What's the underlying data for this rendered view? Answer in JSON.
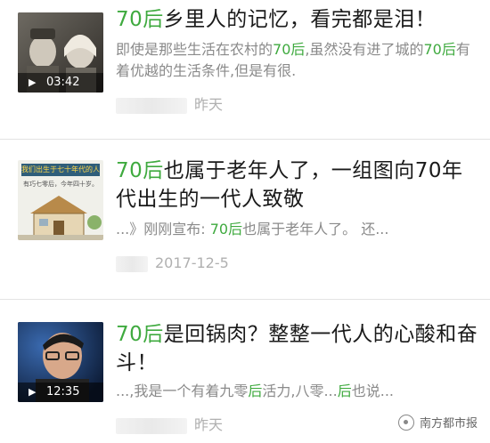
{
  "items": [
    {
      "title_hl": "70后",
      "title_rest": "乡里人的记忆，看完都是泪！",
      "snippet_a": "即使是那些生活在农村的",
      "snippet_hl1": "70后",
      "snippet_b": ",虽然没有进了城的",
      "snippet_hl2": "70后",
      "snippet_c": "有着优越的生活条件,但是有很.",
      "date": "昨天",
      "duration": "03:42"
    },
    {
      "title_hl": "70后",
      "title_rest": "也属于老年人了，一组图向70年代出生的一代人致敬",
      "snippet_a": "...》刚刚宣布: ",
      "snippet_hl1": "70后",
      "snippet_b": "也属于老年人了。 还...",
      "date": "2017-12-5",
      "thumb_banner": "我们出生于七十年代的人们",
      "thumb_sub": "有巧七零后，今年四十岁。"
    },
    {
      "title_hl": "70后",
      "title_rest": "是回锅肉？整整一代人的心酸和奋斗！",
      "snippet_a": "...,我是一个有着九零",
      "snippet_hl1": "后",
      "snippet_b": "活力,八零...",
      "snippet_hl2": "后",
      "snippet_c": "也说...",
      "date": "昨天",
      "duration": "12:35"
    }
  ],
  "watermark": "南方都市报"
}
